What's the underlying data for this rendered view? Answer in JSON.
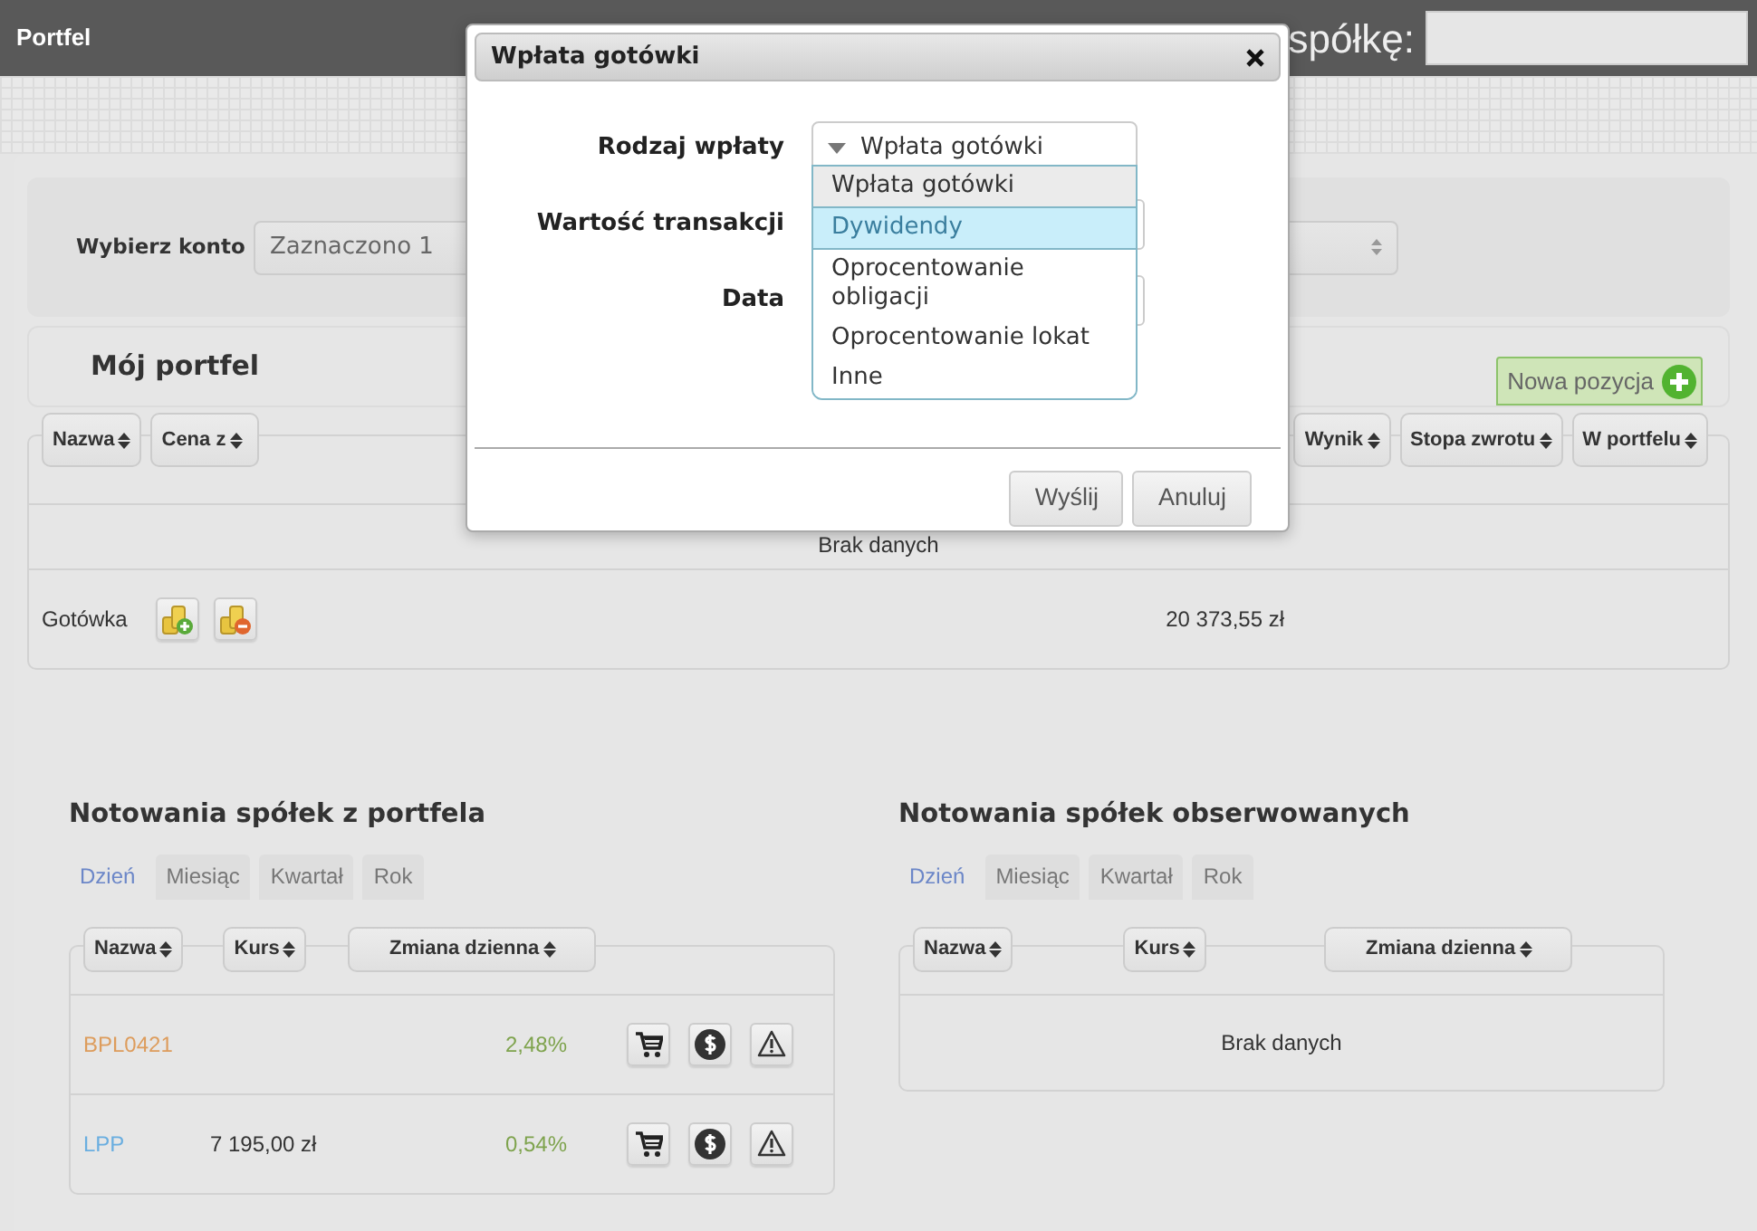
{
  "navbar": {
    "title": "Portfel",
    "search_label": "spółkę:"
  },
  "account": {
    "label": "Wybierz konto",
    "value": "Zaznaczono 1"
  },
  "portfolio": {
    "title": "Mój portfel",
    "add_button": "Nowa pozycja",
    "columns": [
      {
        "label": "Nazwa"
      },
      {
        "label": "Cena z"
      },
      {
        "label": "Wynik"
      },
      {
        "label": "Stopa zwrotu"
      },
      {
        "label": "W portfelu"
      }
    ],
    "empty_text": "Brak danych",
    "cash": {
      "label": "Gotówka",
      "value": "20 373,55 zł"
    }
  },
  "quotes": [
    {
      "title": "Notowania spółek z portfela",
      "tabs": [
        {
          "label": "Dzień",
          "selected": true
        },
        {
          "label": "Miesiąc",
          "selected": false
        },
        {
          "label": "Kwartał",
          "selected": false
        },
        {
          "label": "Rok",
          "selected": false
        }
      ],
      "columns": [
        "Nazwa",
        "Kurs",
        "Zmiana dzienna"
      ],
      "rows": [
        {
          "name": "BPL0421",
          "color": "#dd9c5c",
          "change": "2,48%"
        },
        {
          "name": "LPP",
          "color": "#6aaee0",
          "price": "7 195,00 zł",
          "change": "0,54%"
        }
      ]
    },
    {
      "title": "Notowania spółek obserwowanych",
      "tabs": [
        {
          "label": "Dzień",
          "selected": true
        },
        {
          "label": "Miesiąc",
          "selected": false
        },
        {
          "label": "Kwartał",
          "selected": false
        },
        {
          "label": "Rok",
          "selected": false
        }
      ],
      "columns": [
        "Nazwa",
        "Kurs",
        "Zmiana dzienna"
      ],
      "empty_text": "Brak danych"
    }
  ],
  "modal": {
    "title": "Wpłata gotówki",
    "fields": [
      {
        "label": "Rodzaj wpłaty",
        "kind": "select",
        "value": "Wpłata gotówki",
        "expanded": true
      },
      {
        "label": "Wartość transakcji",
        "kind": "input"
      },
      {
        "label": "Data",
        "kind": "input"
      }
    ],
    "options": [
      {
        "label": "Wpłata gotówki",
        "selected": true,
        "highlighted": false
      },
      {
        "label": "Dywidendy",
        "selected": false,
        "highlighted": true
      },
      {
        "label": "Oprocentowanie obligacji",
        "selected": false,
        "highlighted": false
      },
      {
        "label": "Oprocentowanie lokat",
        "selected": false,
        "highlighted": false
      },
      {
        "label": "Inne",
        "selected": false,
        "highlighted": false
      }
    ],
    "buttons": [
      "Wyślij",
      "Anuluj"
    ]
  }
}
